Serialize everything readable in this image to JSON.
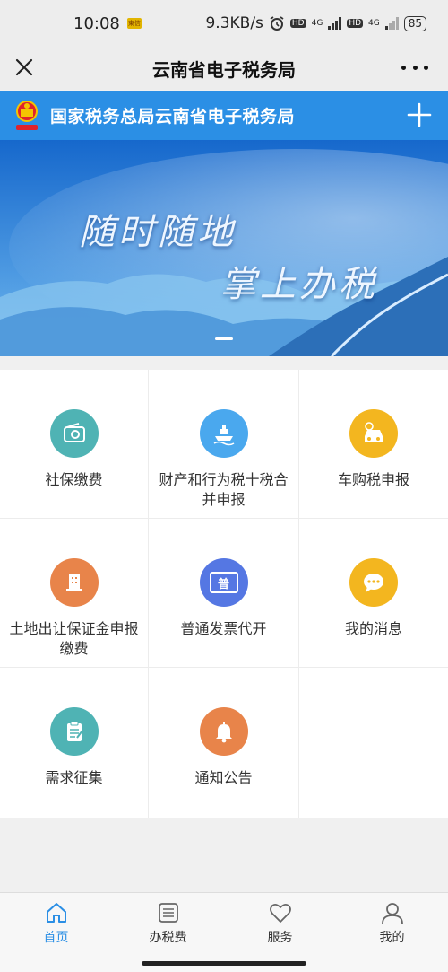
{
  "status_bar": {
    "time": "10:08",
    "sim_badge": "東信",
    "network_speed": "9.3KB/s",
    "hd_1": "HD",
    "net_1": "4G",
    "hd_2": "HD",
    "net_2": "4G",
    "battery": "85"
  },
  "titlebar": {
    "title": "云南省电子税务局"
  },
  "app_header": {
    "name": "国家税务总局云南省电子税务局"
  },
  "banner": {
    "slogan_line1": "随时随地",
    "slogan_line2": "掌上办税"
  },
  "services": [
    {
      "label": "社保缴费",
      "icon": "wallet-icon",
      "color": "#4fb3b4"
    },
    {
      "label": "财产和行为税十税合并申报",
      "icon": "ship-icon",
      "color": "#4aa8ee"
    },
    {
      "label": "车购税申报",
      "icon": "car-icon",
      "color": "#f3b61f"
    },
    {
      "label": "土地出让保证金申报缴费",
      "icon": "building-icon",
      "color": "#e8844a"
    },
    {
      "label": "普通发票代开",
      "icon": "invoice-icon",
      "color": "#5577e3",
      "icon_text": "普"
    },
    {
      "label": "我的消息",
      "icon": "chat-icon",
      "color": "#f3b61f"
    },
    {
      "label": "需求征集",
      "icon": "clipboard-icon",
      "color": "#4fb3b4"
    },
    {
      "label": "通知公告",
      "icon": "bell-icon",
      "color": "#e8844a"
    }
  ],
  "bottom_nav": [
    {
      "label": "首页",
      "icon": "home-icon",
      "active": true
    },
    {
      "label": "办税费",
      "icon": "list-icon",
      "active": false
    },
    {
      "label": "服务",
      "icon": "heart-icon",
      "active": false
    },
    {
      "label": "我的",
      "icon": "user-icon",
      "active": false
    }
  ],
  "colors": {
    "primary": "#2b8fe5",
    "titlebar_bg": "#ededed",
    "page_bg": "#f0f0f0"
  }
}
